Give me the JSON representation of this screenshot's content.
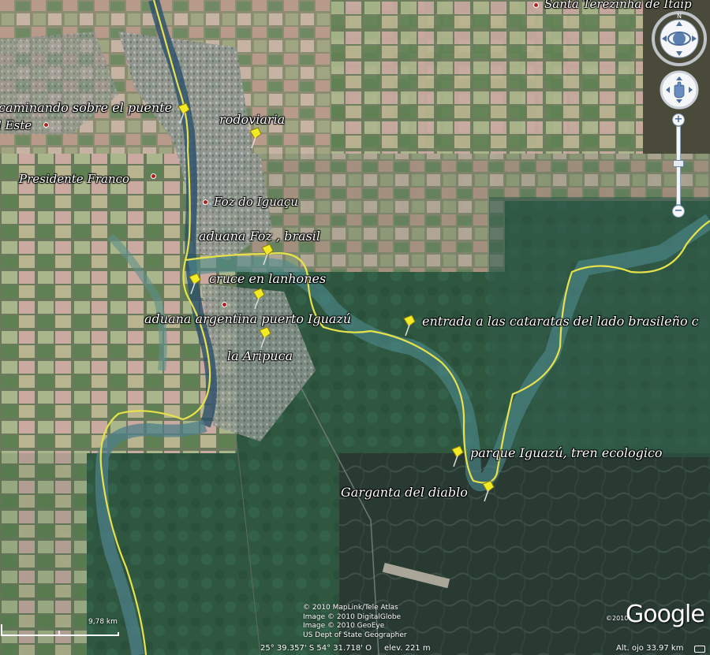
{
  "map": {
    "places": [
      {
        "name": "Santa Terezinha de Itaip",
        "key": "santa"
      },
      {
        "name": "Presidente Franco",
        "key": "franco"
      },
      {
        "name": "Foz do Iguaçu",
        "key": "foz"
      },
      {
        "name": "l Este",
        "key": "este"
      }
    ],
    "placemarks": [
      {
        "label": "caminando sobre el puente",
        "key": "puente"
      },
      {
        "label": "rodoviaria",
        "key": "rodoviaria"
      },
      {
        "label": "aduana  Foz , brasil",
        "key": "aduana_foz"
      },
      {
        "label": "cruce en lanhones",
        "key": "cruce"
      },
      {
        "label": "aduana argentina puerto Iguazú",
        "key": "aduana_arg"
      },
      {
        "label": "la Aripuca",
        "key": "aripuca"
      },
      {
        "label": "entrada a las cataratas del lado brasileño c",
        "key": "entrada"
      },
      {
        "label": "parque Iguazú, tren ecologico",
        "key": "parque"
      },
      {
        "label": "Garganta del diablo",
        "key": "garganta"
      }
    ]
  },
  "credits": {
    "lines": [
      "© 2010 MapLink/Tele Atlas",
      "Image © 2010 DigitalGlobe",
      "Image © 2010 GeoEye",
      "US Dept of State Geographer"
    ],
    "logo": "Google",
    "logo_year": "©2010"
  },
  "scale": {
    "label": "9,78 km"
  },
  "status": {
    "coords": "25° 39.357' S    54° 31.718' O",
    "elev": "elev.  221 m",
    "alt": "Alt. ojo   33.97 km"
  },
  "controls": {
    "zoom_plus": "+",
    "zoom_minus": "−",
    "zoom_level": 0.55
  },
  "colors": {
    "route": "#e8e24a",
    "river": "#5d8f8c",
    "forest": "#2f5a3e",
    "placemark": "#f2ea22"
  }
}
